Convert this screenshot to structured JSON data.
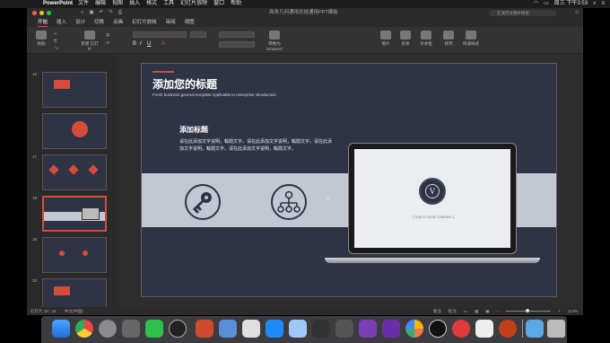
{
  "menubar": {
    "app_name": "PowerPoint",
    "items": [
      "文件",
      "编辑",
      "视图",
      "插入",
      "格式",
      "工具",
      "幻灯片放映",
      "窗口",
      "帮助"
    ],
    "clock": "周三 下午3:53"
  },
  "titlebar": {
    "document_title": "商务几何通用总结通用PPT模板",
    "search_placeholder": "在演示文稿中搜索"
  },
  "ribbon_tabs": [
    "开始",
    "插入",
    "设计",
    "切换",
    "动画",
    "幻灯片放映",
    "审阅",
    "视图"
  ],
  "ribbon": {
    "paste": "粘贴",
    "new_slide": "新建\n幻灯片",
    "convert": "转换为\nSmartArt",
    "picture": "图片",
    "shapes": "形状",
    "textbox": "文本框",
    "arrange": "排列",
    "quick_styles": "快速样式"
  },
  "slides": [
    {
      "number": "16"
    },
    {
      "number": "17"
    },
    {
      "number": "18"
    },
    {
      "number": "19"
    },
    {
      "number": "20"
    }
  ],
  "slide": {
    "title": "添加您的标题",
    "subtitle": "Fresh business general template Applicable to enterprise introduction",
    "section_heading": "添加标题",
    "body_text": "请在此添加文字说明，輸閱文字。请在此添加文字说明，輸閱文字。请在此添加文字说明，輸閱文字。请在此添加文字说明，輸閱文字。",
    "laptop_emblem_letter": "V",
    "laptop_caption": "[ THIS IS YOUR COMPANY ]"
  },
  "statusbar": {
    "slide_info": "幻灯片 18 / 34",
    "language": "中文(中国)",
    "notes": "备注",
    "comments": "批注",
    "zoom": "114%"
  },
  "colors": {
    "accent": "#d54b3c",
    "slide_bg": "#2e3445",
    "band": "#c3c7d1"
  },
  "dock_icons": [
    "finder-icon",
    "chrome-icon",
    "launchpad-icon",
    "settings-icon",
    "wechat-icon",
    "qq-icon",
    "appstore-icon",
    "powerpoint-icon",
    "trash-icon"
  ]
}
